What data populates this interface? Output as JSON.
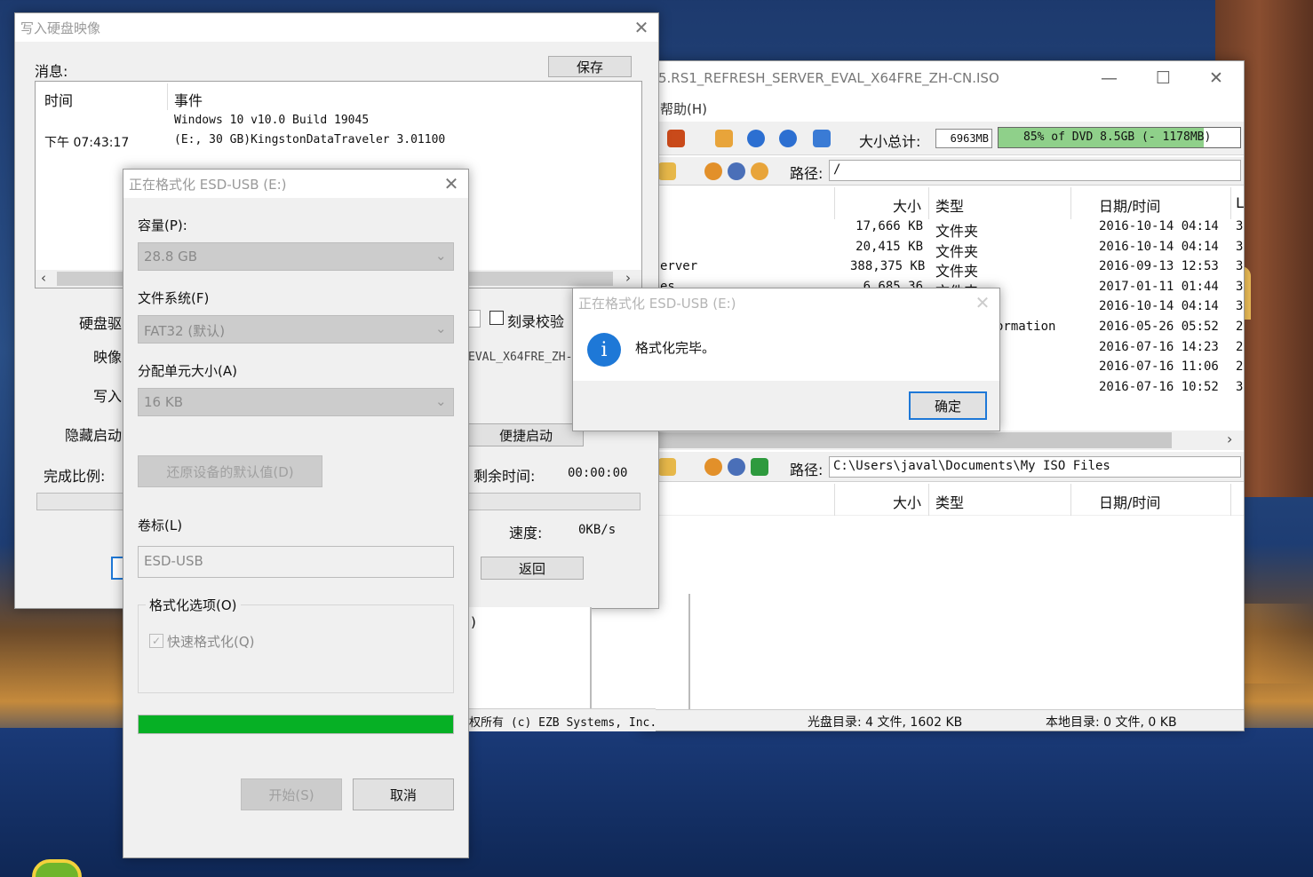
{
  "colors": {
    "accent_blue": "#1e78d7",
    "progress_green": "#06b025",
    "disabled_gray": "#a0a0a0"
  },
  "iso_window": {
    "title": "5.RS1_REFRESH_SERVER_EVAL_X64FRE_ZH-CN.ISO",
    "menu_help": "帮助(H)",
    "size_total_label": "大小总计:",
    "size_total_value": "6963MB",
    "capacity_text": "85% of DVD 8.5GB (- 1178MB)",
    "capacity_fraction": 0.85,
    "top_path_label": "路径:",
    "top_path_value": "/",
    "columns": {
      "size": "大小",
      "type": "类型",
      "date": "日期/时间",
      "extra": "L"
    },
    "rows": [
      {
        "name": "",
        "size": "17,666 KB",
        "type": "文件夹",
        "date": "2016-10-14 04:14",
        "extra": "3"
      },
      {
        "name": "",
        "size": "20,415 KB",
        "type": "文件夹",
        "date": "2016-10-14 04:14",
        "extra": "3"
      },
      {
        "name": "erver",
        "size": "388,375 KB",
        "type": "文件夹",
        "date": "2016-09-13 12:53",
        "extra": "3"
      },
      {
        "name": "es",
        "size": "6,685,36",
        "type": "文件夹",
        "date": "2017-01-11 01:44",
        "extra": "3"
      },
      {
        "name": "",
        "size": "",
        "type": "",
        "date": "2016-10-14 04:14",
        "extra": "3"
      },
      {
        "name": "",
        "size": "",
        "type": "ormation",
        "date": "2016-05-26 05:52",
        "extra": "2"
      },
      {
        "name": "",
        "size": "",
        "type": "",
        "date": "2016-07-16 14:23",
        "extra": "2"
      },
      {
        "name": "",
        "size": "",
        "type": "",
        "date": "2016-07-16 11:06",
        "extra": "2"
      },
      {
        "name": "",
        "size": "",
        "type": "",
        "date": "2016-07-16 10:52",
        "extra": "3"
      }
    ],
    "bottom_path_label": "路径:",
    "bottom_path_value": "C:\\Users\\javal\\Documents\\My ISO Files",
    "bottom_columns": {
      "size": "大小",
      "type": "类型",
      "date": "日期/时间"
    },
    "status_copyright": "权所有 (c) EZB Systems, Inc.",
    "status_disc": "光盘目录: 4 文件, 1602 KB",
    "status_local": "本地目录: 0 文件, 0 KB"
  },
  "write_dialog": {
    "title": "写入硬盘映像",
    "messages_label": "消息:",
    "save_button": "保存",
    "log_columns": {
      "time": "时间",
      "event": "事件"
    },
    "log_rows": [
      {
        "time": "",
        "event": "Windows 10 v10.0 Build 19045"
      },
      {
        "time": "下午 07:43:17",
        "event": "(E:, 30 GB)KingstonDataTraveler 3.01100"
      }
    ],
    "disk_drive_label": "硬盘驱",
    "image_label": "映像",
    "write_label": "写入",
    "hidden_boot_label": "隐藏启动",
    "verify_checkbox": "刻录校验",
    "image_path_fragment": "EVAL_X64FRE_ZH-",
    "quick_boot_button": "便捷启动",
    "completion_label": "完成比例:",
    "remaining_label": "剩余时间:",
    "remaining_value": "00:00:00",
    "speed_label": "速度:",
    "speed_value": "0KB/s",
    "back_button": "返回",
    "paren_fragment": ")"
  },
  "format_dialog": {
    "title": "正在格式化 ESD-USB (E:)",
    "capacity_label": "容量(P):",
    "capacity_value": "28.8 GB",
    "filesystem_label": "文件系统(F)",
    "filesystem_value": "FAT32 (默认)",
    "alloc_label": "分配单元大小(A)",
    "alloc_value": "16 KB",
    "restore_button": "还原设备的默认值(D)",
    "volume_label": "卷标(L)",
    "volume_value": "ESD-USB",
    "options_label": "格式化选项(O)",
    "quick_format_label": "快速格式化(Q)",
    "quick_format_checked": true,
    "progress_fraction": 1.0,
    "start_button": "开始(S)",
    "cancel_button": "取消"
  },
  "done_dialog": {
    "title": "正在格式化 ESD-USB (E:)",
    "message": "格式化完毕。",
    "ok_button": "确定",
    "info_icon_glyph": "i"
  }
}
